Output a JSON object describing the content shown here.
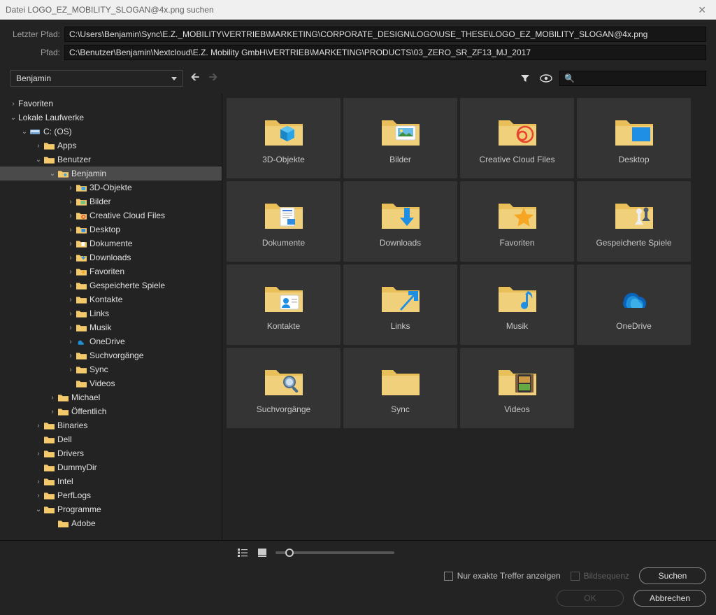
{
  "title": "Datei LOGO_EZ_MOBILITY_SLOGAN@4x.png suchen",
  "labels": {
    "last_path": "Letzter Pfad:",
    "path": "Pfad:"
  },
  "last_path_value": "C:\\Users\\Benjamin\\Sync\\E.Z._MOBILITY\\VERTRIEB\\MARKETING\\CORPORATE_DESIGN\\LOGO\\USE_THESE\\LOGO_EZ_MOBILITY_SLOGAN@4x.png",
  "path_value": "C:\\Benutzer\\Benjamin\\Nextcloud\\E.Z. Mobility GmbH\\VERTRIEB\\MARKETING\\PRODUCTS\\03_ZERO_SR_ZF13_MJ_2017",
  "dropdown_current": "Benjamin",
  "tree": {
    "favoriten": "Favoriten",
    "lokale": "Lokale Laufwerke",
    "c_os": "C: (OS)",
    "apps": "Apps",
    "benutzer": "Benutzer",
    "benjamin": "Benjamin",
    "d3": "3D-Objekte",
    "bilder": "Bilder",
    "ccf": "Creative Cloud Files",
    "desktop": "Desktop",
    "dok": "Dokumente",
    "dl": "Downloads",
    "fav": "Favoriten",
    "gs": "Gespeicherte Spiele",
    "kont": "Kontakte",
    "links": "Links",
    "musik": "Musik",
    "onedrive": "OneDrive",
    "suchv": "Suchvorgänge",
    "sync": "Sync",
    "videos": "Videos",
    "michael": "Michael",
    "off": "Öffentlich",
    "binaries": "Binaries",
    "dell": "Dell",
    "drivers": "Drivers",
    "dummy": "DummyDir",
    "intel": "Intel",
    "perflogs": "PerfLogs",
    "programme": "Programme",
    "adobe": "Adobe"
  },
  "grid": {
    "d3": "3D-Objekte",
    "bilder": "Bilder",
    "ccf": "Creative Cloud Files",
    "desktop": "Desktop",
    "dok": "Dokumente",
    "dl": "Downloads",
    "fav": "Favoriten",
    "gs": "Gespeicherte Spiele",
    "kont": "Kontakte",
    "links": "Links",
    "musik": "Musik",
    "onedrive": "OneDrive",
    "suchv": "Suchvorgänge",
    "sync": "Sync",
    "videos": "Videos"
  },
  "footer": {
    "exact": "Nur exakte Treffer anzeigen",
    "seq": "Bildsequenz",
    "search": "Suchen",
    "ok": "OK",
    "cancel": "Abbrechen"
  }
}
